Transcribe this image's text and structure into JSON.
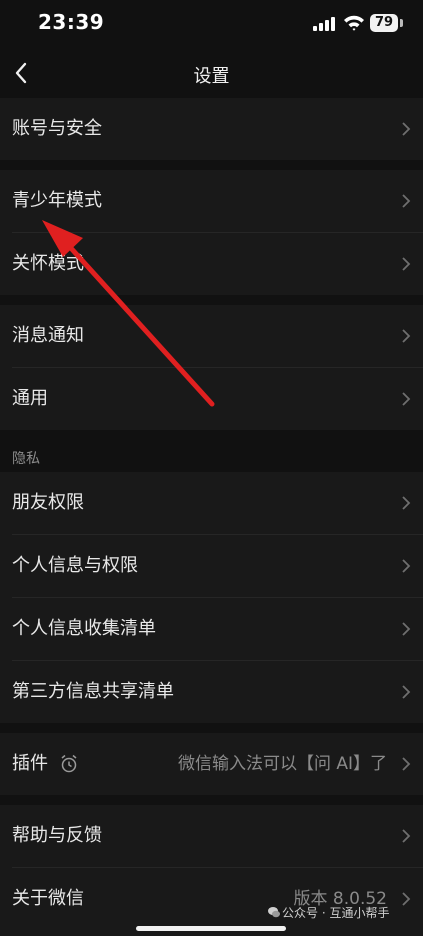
{
  "status_bar": {
    "time": "23:39",
    "battery": "79"
  },
  "nav": {
    "title": "设置",
    "back_icon": "chevron-left-icon"
  },
  "groups": {
    "account": {
      "label": "账号与安全"
    },
    "youth": {
      "label": "青少年模式"
    },
    "care": {
      "label": "关怀模式"
    },
    "notify": {
      "label": "消息通知"
    },
    "general": {
      "label": "通用"
    },
    "privacy_header": "隐私",
    "friends": {
      "label": "朋友权限"
    },
    "personal_info": {
      "label": "个人信息与权限"
    },
    "info_collection": {
      "label": "个人信息收集清单"
    },
    "third_party": {
      "label": "第三方信息共享清单"
    },
    "plugins": {
      "label": "插件",
      "value": "微信输入法可以【问 AI】了"
    },
    "help": {
      "label": "帮助与反馈"
    },
    "about": {
      "label": "关于微信",
      "value": "版本 8.0.52"
    }
  },
  "watermark": "公众号 · 互通小帮手",
  "colors": {
    "background": "#111111",
    "row": "#191919",
    "arrow": "#e02020"
  }
}
